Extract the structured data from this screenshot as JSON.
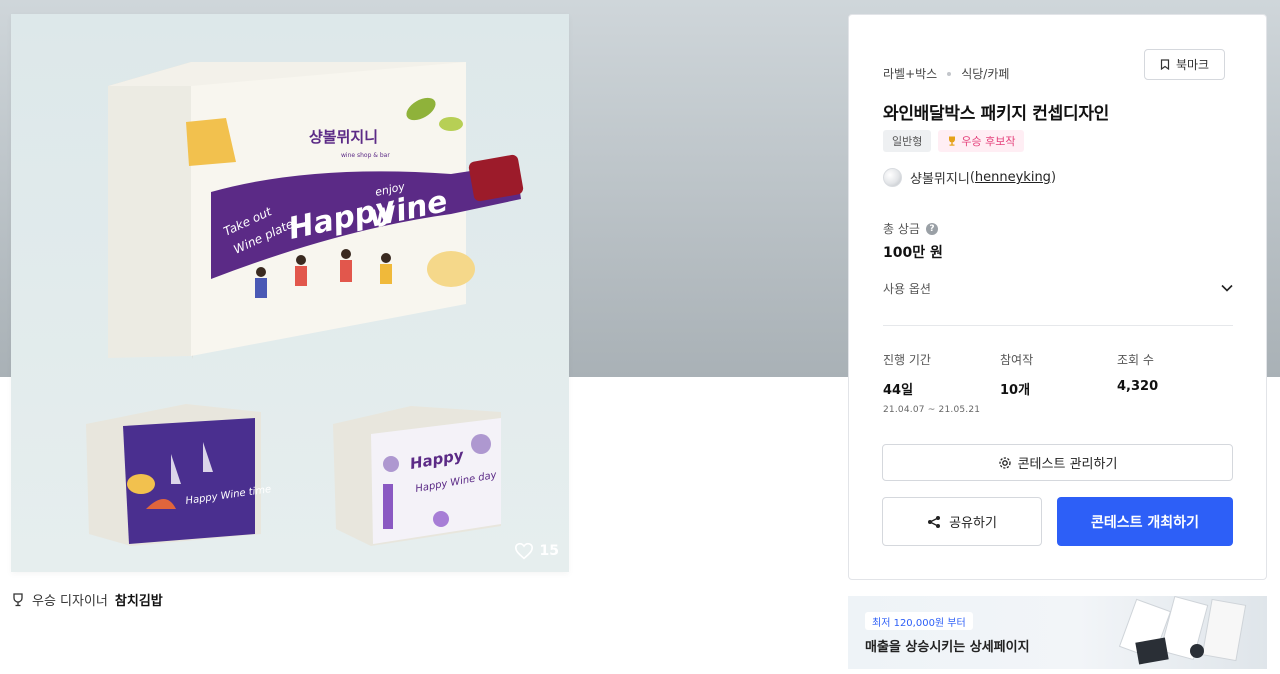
{
  "gallery": {
    "like_count": "15",
    "winner_prefix": "우승 디자이너",
    "winner_name": "참치김밥",
    "box_texts": {
      "brand_kr": "샹볼뮈지니",
      "brand_sub": "wine shop & bar",
      "take_out": "Take out",
      "wine_plate": "Wine plate",
      "happy": "Happy",
      "enjoy": "enjoy",
      "wine": "wine",
      "happy_wine_time": "Happy Wine time",
      "happy_wine_day": "Happy Wine day"
    }
  },
  "panel": {
    "breadcrumb": [
      "라벨+박스",
      "식당/카페"
    ],
    "bookmark_label": "북마크",
    "title": "와인배달박스 패키지 컨셉디자인",
    "tags": [
      {
        "label": "일반형"
      },
      {
        "label": "우승 후보작"
      }
    ],
    "author_name": "샹볼뮈지니",
    "author_handle": "henneyking",
    "prize_label": "총 상금",
    "prize_value": "100만 원",
    "options_label": "사용 옵션",
    "stats": [
      {
        "label": "진행 기간",
        "value": "44일",
        "sub": "21.04.07 ~ 21.05.21"
      },
      {
        "label": "참여작",
        "value": "10개"
      },
      {
        "label": "조회 수",
        "value": "4,320"
      }
    ],
    "manage_label": "콘테스트 관리하기",
    "share_label": "공유하기",
    "host_label": "콘테스트 개최하기"
  },
  "ad": {
    "badge": "최저 120,000원 부터",
    "text": "매출을 상승시키는 상세페이지"
  },
  "colors": {
    "primary": "#2d5ff7",
    "wine_purple": "#5b2a86",
    "candidate_pink": "#e5427c"
  }
}
